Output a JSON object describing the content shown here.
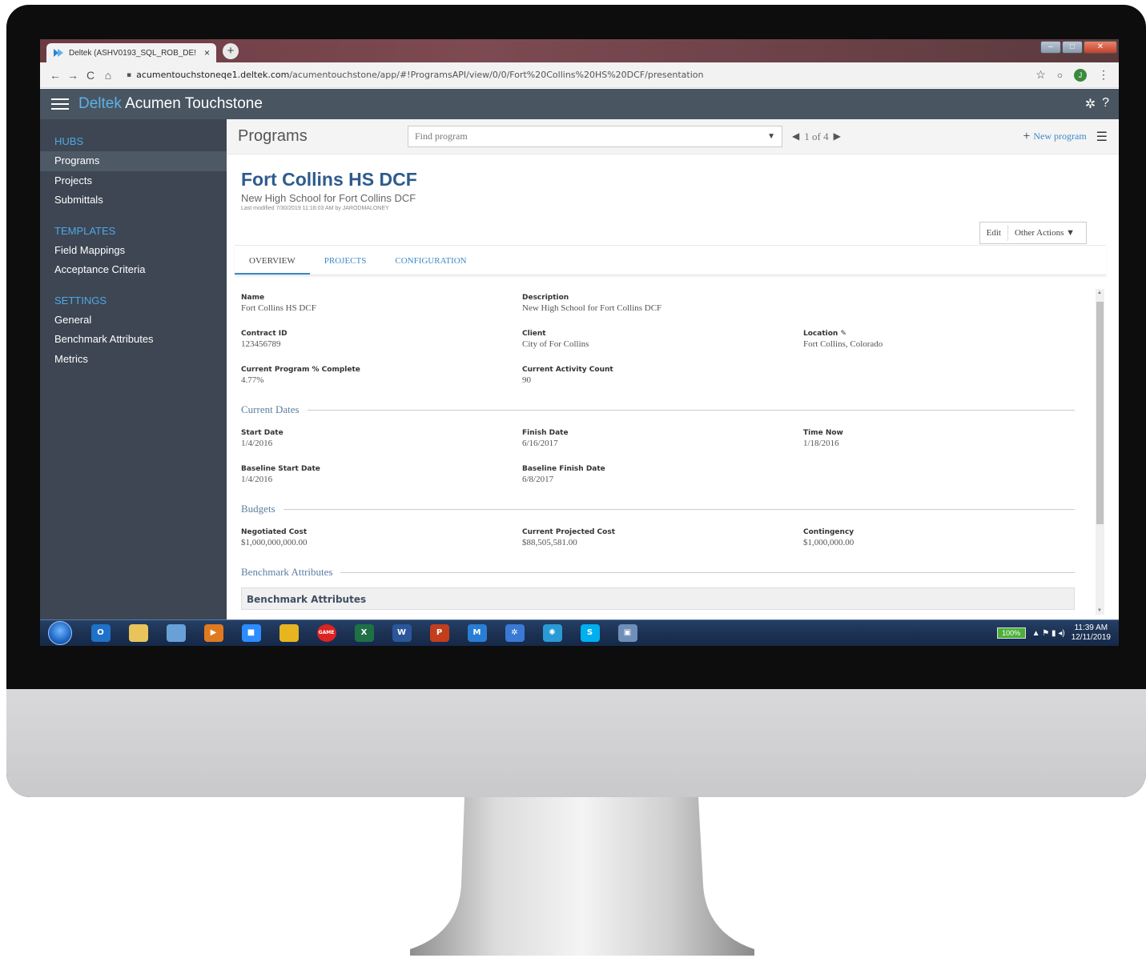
{
  "browser": {
    "tab_title": "Deltek (ASHV0193_SQL_ROB_DE!",
    "tab_close": "×",
    "new_tab": "+",
    "url_host": "acumentouchstoneqe1.deltek.com",
    "url_path": "/acumentouchstone/app/#!ProgramsAPI/view/0/0/Fort%20Collins%20HS%20DCF/presentation",
    "back_icon": "←",
    "forward_icon": "→",
    "reload_icon": "C",
    "home_icon": "⌂",
    "lock_icon": "🔒",
    "star_icon": "☆",
    "ext_icon": "○",
    "avatar": "J",
    "menu_icon": "⋮"
  },
  "app": {
    "brand_part1": "Deltek",
    "brand_part2": "Acumen Touchstone",
    "settings_icon": "✲",
    "help_icon": "?"
  },
  "sidebar": {
    "hubs_heading": "HUBS",
    "hubs": [
      "Programs",
      "Projects",
      "Submittals"
    ],
    "templates_heading": "TEMPLATES",
    "templates": [
      "Field Mappings",
      "Acceptance Criteria"
    ],
    "settings_heading": "SETTINGS",
    "settings": [
      "General",
      "Benchmark Attributes",
      "Metrics"
    ]
  },
  "programs_bar": {
    "title": "Programs",
    "find_placeholder": "Find program",
    "pager_text": "1 of 4",
    "new_program": "New program"
  },
  "program": {
    "title": "Fort Collins HS DCF",
    "subtitle": "New High School for Fort Collins DCF",
    "last_modified": "Last modified 7/30/2019 11:16:03 AM by JARODMALONEY",
    "edit_label": "Edit",
    "other_actions_label": "Other Actions ▼"
  },
  "tabs": [
    "OVERVIEW",
    "PROJECTS",
    "CONFIGURATION"
  ],
  "fields": {
    "name": {
      "label": "Name",
      "value": "Fort Collins HS DCF"
    },
    "description": {
      "label": "Description",
      "value": "New High School for Fort Collins DCF"
    },
    "contract_id": {
      "label": "Contract ID",
      "value": "123456789"
    },
    "client": {
      "label": "Client",
      "value": "City of For Collins"
    },
    "location": {
      "label": "Location",
      "value": "Fort Collins, Colorado"
    },
    "pct_complete": {
      "label": "Current Program % Complete",
      "value": "4.77%"
    },
    "activity_count": {
      "label": "Current Activity Count",
      "value": "90"
    },
    "start_date": {
      "label": "Start Date",
      "value": "1/4/2016"
    },
    "finish_date": {
      "label": "Finish Date",
      "value": "6/16/2017"
    },
    "time_now": {
      "label": "Time Now",
      "value": "1/18/2016"
    },
    "baseline_start": {
      "label": "Baseline Start Date",
      "value": "1/4/2016"
    },
    "baseline_finish": {
      "label": "Baseline Finish Date",
      "value": "6/8/2017"
    },
    "negotiated_cost": {
      "label": "Negotiated Cost",
      "value": "$1,000,000,000.00"
    },
    "projected_cost": {
      "label": "Current Projected Cost",
      "value": "$88,505,581.00"
    },
    "contingency": {
      "label": "Contingency",
      "value": "$1,000,000.00"
    }
  },
  "sections": {
    "dates": "Current Dates",
    "budgets": "Budgets",
    "benchmark": "Benchmark Attributes",
    "benchmark_table_header": "Benchmark Attributes"
  },
  "taskbar": {
    "icons": [
      {
        "name": "outlook-icon",
        "glyph": "O",
        "color": "#1e72c8"
      },
      {
        "name": "file-explorer-icon",
        "glyph": "",
        "color": "#e8c45a"
      },
      {
        "name": "paint-icon",
        "glyph": "",
        "color": "#6aa0d8"
      },
      {
        "name": "media-player-icon",
        "glyph": "▶",
        "color": "#e07a1f"
      },
      {
        "name": "zoom-icon",
        "glyph": "■",
        "color": "#2d8cff"
      },
      {
        "name": "chrome-icon",
        "glyph": "",
        "color": "#e6b51f"
      },
      {
        "name": "game-icon",
        "glyph": "GAME",
        "color": "#d22"
      },
      {
        "name": "excel-icon",
        "glyph": "X",
        "color": "#1e7145"
      },
      {
        "name": "word-icon",
        "glyph": "W",
        "color": "#2b579a"
      },
      {
        "name": "powerpoint-icon",
        "glyph": "P",
        "color": "#c43e1c"
      },
      {
        "name": "m-app-icon",
        "glyph": "M",
        "color": "#2a7dd4"
      },
      {
        "name": "teams-icon",
        "glyph": "✲",
        "color": "#3a7ad4"
      },
      {
        "name": "spinner-app-icon",
        "glyph": "✺",
        "color": "#2a9ad4"
      },
      {
        "name": "skype-icon",
        "glyph": "S",
        "color": "#00aff0"
      },
      {
        "name": "remote-desktop-icon",
        "glyph": "▣",
        "color": "#6d8fb8"
      }
    ],
    "battery": "100%",
    "time": "11:39 AM",
    "date": "12/11/2019"
  }
}
